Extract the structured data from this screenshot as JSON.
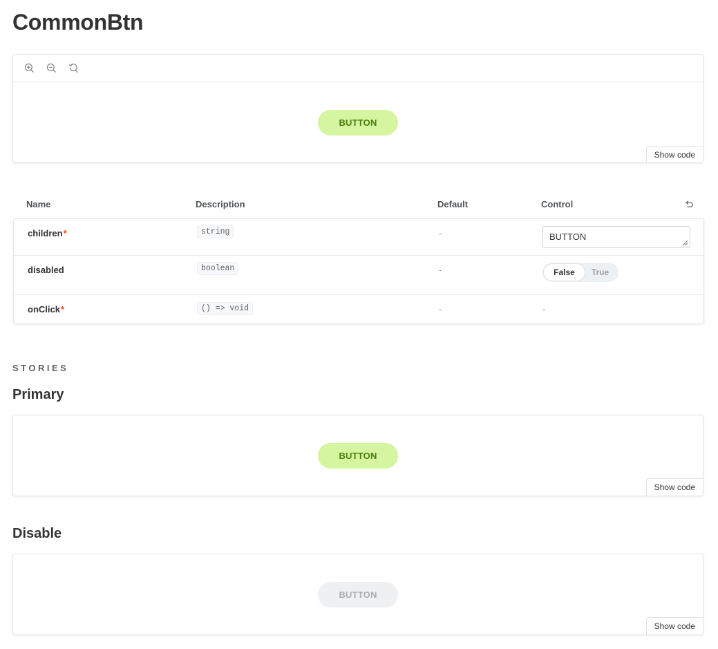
{
  "page": {
    "title": "CommonBtn"
  },
  "canvas": {
    "toolbar": {
      "zoom_in": "zoom-in-icon",
      "zoom_out": "zoom-out-icon",
      "reset": "zoom-reset-icon"
    },
    "button_label": "BUTTON",
    "show_code": "Show code"
  },
  "args_table": {
    "headers": {
      "name": "Name",
      "description": "Description",
      "default": "Default",
      "control": "Control"
    },
    "rows": [
      {
        "name": "children",
        "required": "*",
        "type": "string",
        "default": "-",
        "control_value": "BUTTON"
      },
      {
        "name": "disabled",
        "required": "",
        "type": "boolean",
        "default": "-",
        "toggle_false": "False",
        "toggle_true": "True",
        "selected": "False"
      },
      {
        "name": "onClick",
        "required": "*",
        "type": "() => void",
        "default": "-",
        "control_value": "-"
      }
    ]
  },
  "stories": {
    "label": "STORIES",
    "items": [
      {
        "title": "Primary",
        "button_label": "BUTTON",
        "show_code": "Show code",
        "disabled": false
      },
      {
        "title": "Disable",
        "button_label": "BUTTON",
        "show_code": "Show code",
        "disabled": true
      }
    ]
  },
  "colors": {
    "primary_bg": "#d6f5a0",
    "primary_text": "#4a7c0c",
    "disabled_bg": "#eff0f2",
    "disabled_text": "#a9aeb5",
    "required_marker": "#ff4400"
  }
}
